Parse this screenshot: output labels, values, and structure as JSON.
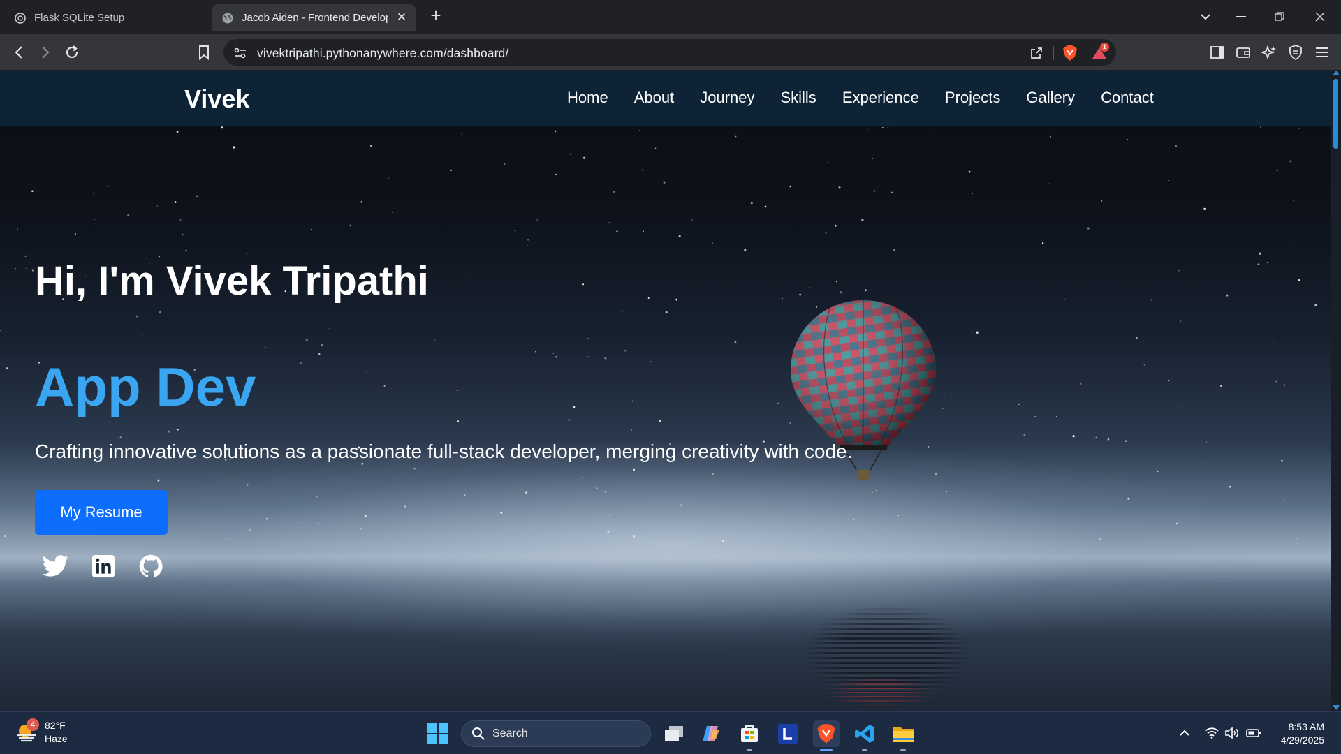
{
  "browser": {
    "tabs": [
      {
        "title": "Flask SQLite Setup",
        "active": false
      },
      {
        "title": "Jacob Aiden - Frontend Developer",
        "active": true
      }
    ],
    "url": "vivektripathi.pythonanywhere.com/dashboard/",
    "alert_count": "1"
  },
  "site": {
    "brand": "Vivek",
    "nav": [
      "Home",
      "About",
      "Journey",
      "Skills",
      "Experience",
      "Projects",
      "Gallery",
      "Contact"
    ],
    "hero": {
      "greeting": "Hi, I'm Vivek Tripathi",
      "role": "App Dev",
      "tagline": "Crafting innovative solutions as a passionate full-stack developer, merging creativity with code.",
      "resume_button": "My Resume"
    },
    "socials": [
      "twitter-icon",
      "linkedin-icon",
      "github-icon"
    ],
    "colors": {
      "nav_bg": "#0f2336",
      "accent": "#3aa6f2",
      "button": "#0d6efd"
    }
  },
  "taskbar": {
    "weather": {
      "temp": "82°F",
      "condition": "Haze",
      "badge": "4"
    },
    "search_label": "Search",
    "apps": [
      "task-view",
      "copilot",
      "microsoft-store",
      "l-app",
      "brave-browser",
      "vscode",
      "file-explorer"
    ],
    "time": "8:53 AM",
    "date": "4/29/2025"
  }
}
